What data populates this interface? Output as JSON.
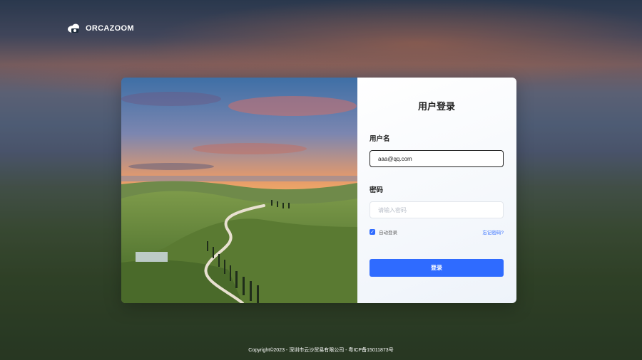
{
  "brand": {
    "name": "ORCAZOOM"
  },
  "login": {
    "title": "用户登录",
    "username_label": "用户名",
    "username_value": "aaa@qq.com",
    "password_label": "密码",
    "password_placeholder": "请输入密码",
    "remember_label": "自动登录",
    "remember_checked": true,
    "forgot_label": "忘记密码?",
    "submit_label": "登录"
  },
  "footer": {
    "text": "Copyright©2023 - 深圳市云沙贸易有限公司 - 粤ICP备15011873号"
  },
  "colors": {
    "accent": "#2f6bff"
  }
}
